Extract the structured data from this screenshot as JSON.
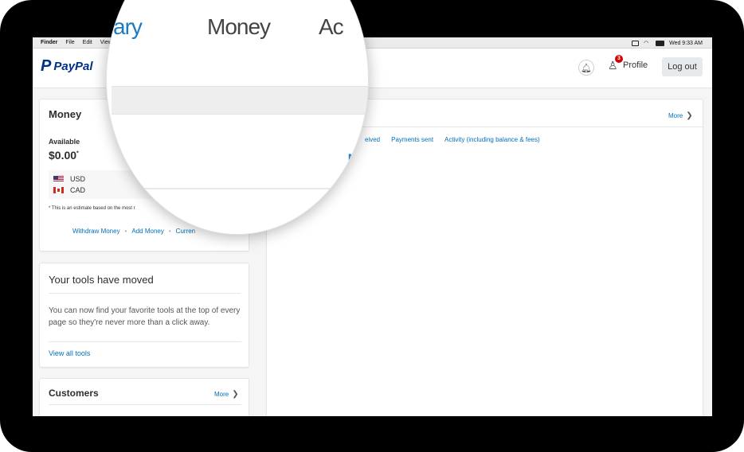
{
  "menubar": {
    "items": [
      "Finder",
      "File",
      "Edit",
      "View"
    ],
    "clock": "Wed 9:33 AM"
  },
  "header": {
    "logo_mark": "P",
    "logo_text": "PayPal",
    "notifications_badge": "3",
    "profile_label": "Profile",
    "logout_label": "Log out"
  },
  "magnifier": {
    "text_left": "ary",
    "text_mid": "Money",
    "text_right": "Ac",
    "text_corner": "M"
  },
  "money": {
    "title": "Money",
    "available_label": "Available",
    "amount": "$0.00",
    "amount_marker": "*",
    "currencies": [
      {
        "code": "USD",
        "flag": "us-flag-icon"
      },
      {
        "code": "CAD",
        "flag": "ca-flag-icon"
      }
    ],
    "note": "* This is an estimate based on the most r",
    "links": [
      "Withdraw Money",
      "Add Money",
      "Curren"
    ]
  },
  "tools": {
    "title": "Your tools have moved",
    "body": "You can now find your favorite tools at the top of every page so they're never more than a click away.",
    "link": "View all tools"
  },
  "customers": {
    "title": "Customers",
    "more": "More"
  },
  "activity": {
    "more": "More",
    "tabs": [
      "eived",
      "Payments sent",
      "Activity (including balance & fees)"
    ]
  },
  "colors": {
    "brand_dark": "#003087",
    "brand_light": "#009cde",
    "link": "#0070ba",
    "badge": "#d20000"
  }
}
